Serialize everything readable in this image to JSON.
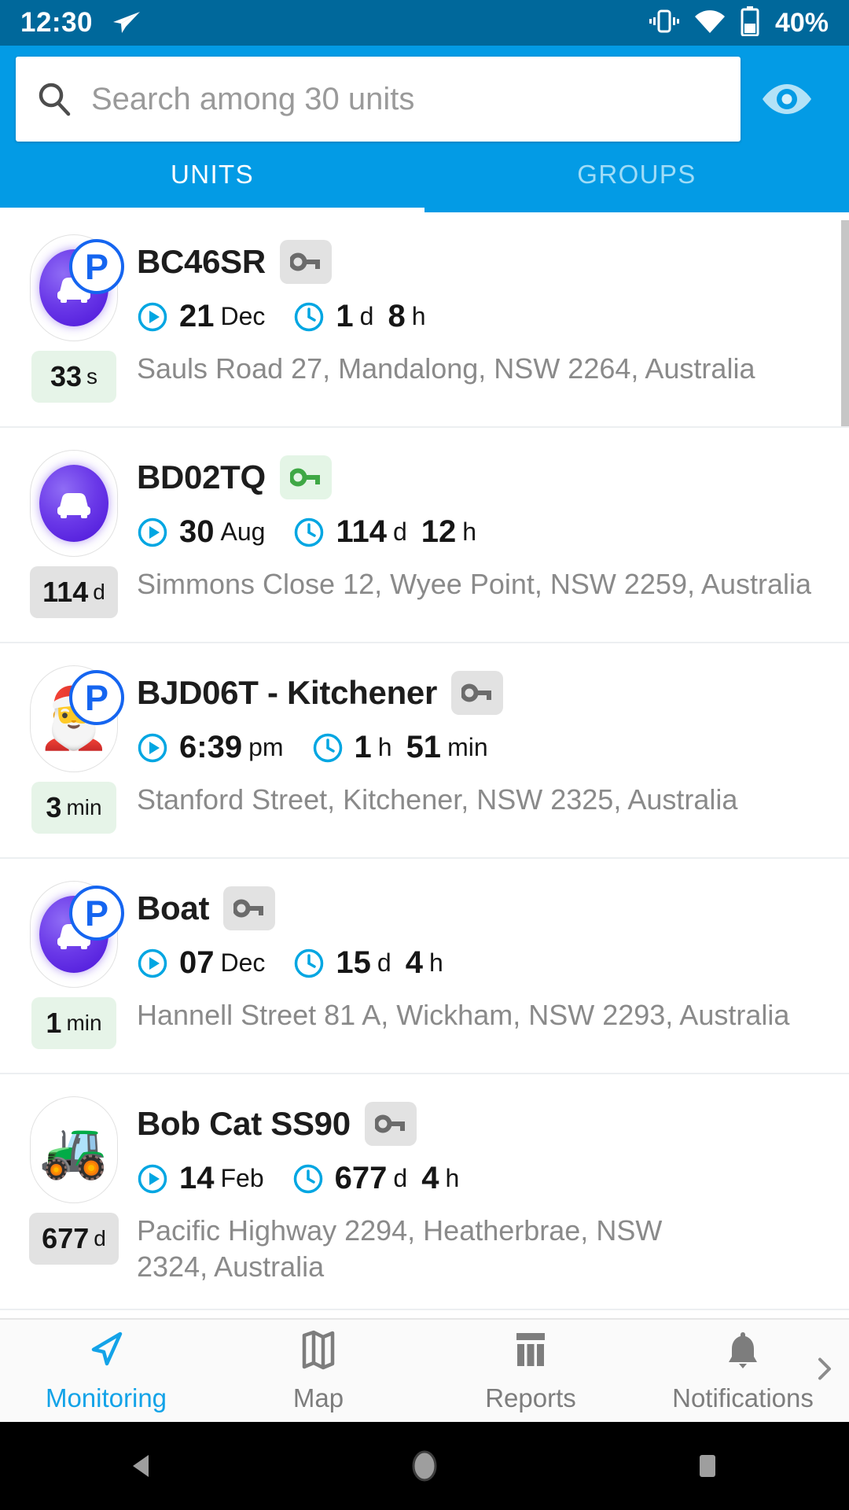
{
  "status_bar": {
    "time": "12:30",
    "battery_percent": "40%",
    "icons": [
      "send-icon",
      "vibrate-icon",
      "wifi-icon",
      "battery-icon"
    ]
  },
  "search": {
    "placeholder": "Search among 30 units",
    "value": "",
    "icon": "search-icon",
    "eye_icon": "eye-icon"
  },
  "tabs": [
    {
      "label": "UNITS",
      "active": true
    },
    {
      "label": "GROUPS",
      "active": false
    }
  ],
  "colors": {
    "status_bar": "#00689B",
    "header": "#039BE5",
    "accent": "#13A3E8",
    "tab_inactive": "#9fdcf7",
    "address_text": "#8a8a8a",
    "key_on": "#3FA845",
    "key_off": "#6b6b6b",
    "badge_green_bg": "#e6f4e8",
    "badge_grey_bg": "#e2e2e2",
    "unit_marker": "#4B14D8",
    "parking_badge": "#1565F0"
  },
  "units": [
    {
      "name": "BC46SR",
      "avatar": "car-icon",
      "parking": true,
      "ignition": "off",
      "date_icon": "play-circle-icon",
      "date_value": "21",
      "date_unit": "Dec",
      "duration_icon": "clock-icon",
      "duration": [
        {
          "value": "1",
          "unit": "d"
        },
        {
          "value": "8",
          "unit": "h"
        }
      ],
      "last_update_value": "33",
      "last_update_unit": "s",
      "last_update_state": "green",
      "address": "Sauls Road 27, Mandalong, NSW 2264, Australia"
    },
    {
      "name": "BD02TQ",
      "avatar": "car-icon",
      "parking": false,
      "ignition": "on",
      "date_icon": "play-circle-icon",
      "date_value": "30",
      "date_unit": "Aug",
      "duration_icon": "clock-icon",
      "duration": [
        {
          "value": "114",
          "unit": "d"
        },
        {
          "value": "12",
          "unit": "h"
        }
      ],
      "last_update_value": "114",
      "last_update_unit": "d",
      "last_update_state": "grey",
      "address": "Simmons Close 12, Wyee Point, NSW 2259, Australia"
    },
    {
      "name": "BJD06T - Kitchener",
      "avatar": "santa-icon",
      "parking": true,
      "ignition": "off",
      "date_icon": "play-circle-icon",
      "date_value": "6:39",
      "date_unit": "pm",
      "duration_icon": "clock-icon",
      "duration": [
        {
          "value": "1",
          "unit": "h"
        },
        {
          "value": "51",
          "unit": "min"
        }
      ],
      "last_update_value": "3",
      "last_update_unit": "min",
      "last_update_state": "green",
      "address": "Stanford Street, Kitchener, NSW 2325, Australia"
    },
    {
      "name": "Boat",
      "avatar": "car-icon",
      "parking": true,
      "ignition": "off",
      "date_icon": "play-circle-icon",
      "date_value": "07",
      "date_unit": "Dec",
      "duration_icon": "clock-icon",
      "duration": [
        {
          "value": "15",
          "unit": "d"
        },
        {
          "value": "4",
          "unit": "h"
        }
      ],
      "last_update_value": "1",
      "last_update_unit": "min",
      "last_update_state": "green",
      "address": "Hannell Street 81 A, Wickham, NSW 2293, Australia"
    },
    {
      "name": "Bob Cat SS90",
      "avatar": "bulldozer-icon",
      "parking": false,
      "ignition": "off",
      "date_icon": "play-circle-icon",
      "date_value": "14",
      "date_unit": "Feb",
      "duration_icon": "clock-icon",
      "duration": [
        {
          "value": "677",
          "unit": "d"
        },
        {
          "value": "4",
          "unit": "h"
        }
      ],
      "last_update_value": "677",
      "last_update_unit": "d",
      "last_update_state": "grey",
      "address": "Pacific Highway 2294, Heatherbrae, NSW 2324, Australia"
    }
  ],
  "bottom_nav": [
    {
      "label": "Monitoring",
      "icon": "navigation-arrow-icon",
      "active": true
    },
    {
      "label": "Map",
      "icon": "map-icon",
      "active": false
    },
    {
      "label": "Reports",
      "icon": "reports-icon",
      "active": false
    },
    {
      "label": "Notifications",
      "icon": "bell-icon",
      "active": false
    }
  ],
  "bottom_nav_more_icon": "chevron-right-icon",
  "system_nav": [
    {
      "icon": "back-triangle-icon"
    },
    {
      "icon": "home-circle-icon"
    },
    {
      "icon": "recents-square-icon"
    }
  ]
}
